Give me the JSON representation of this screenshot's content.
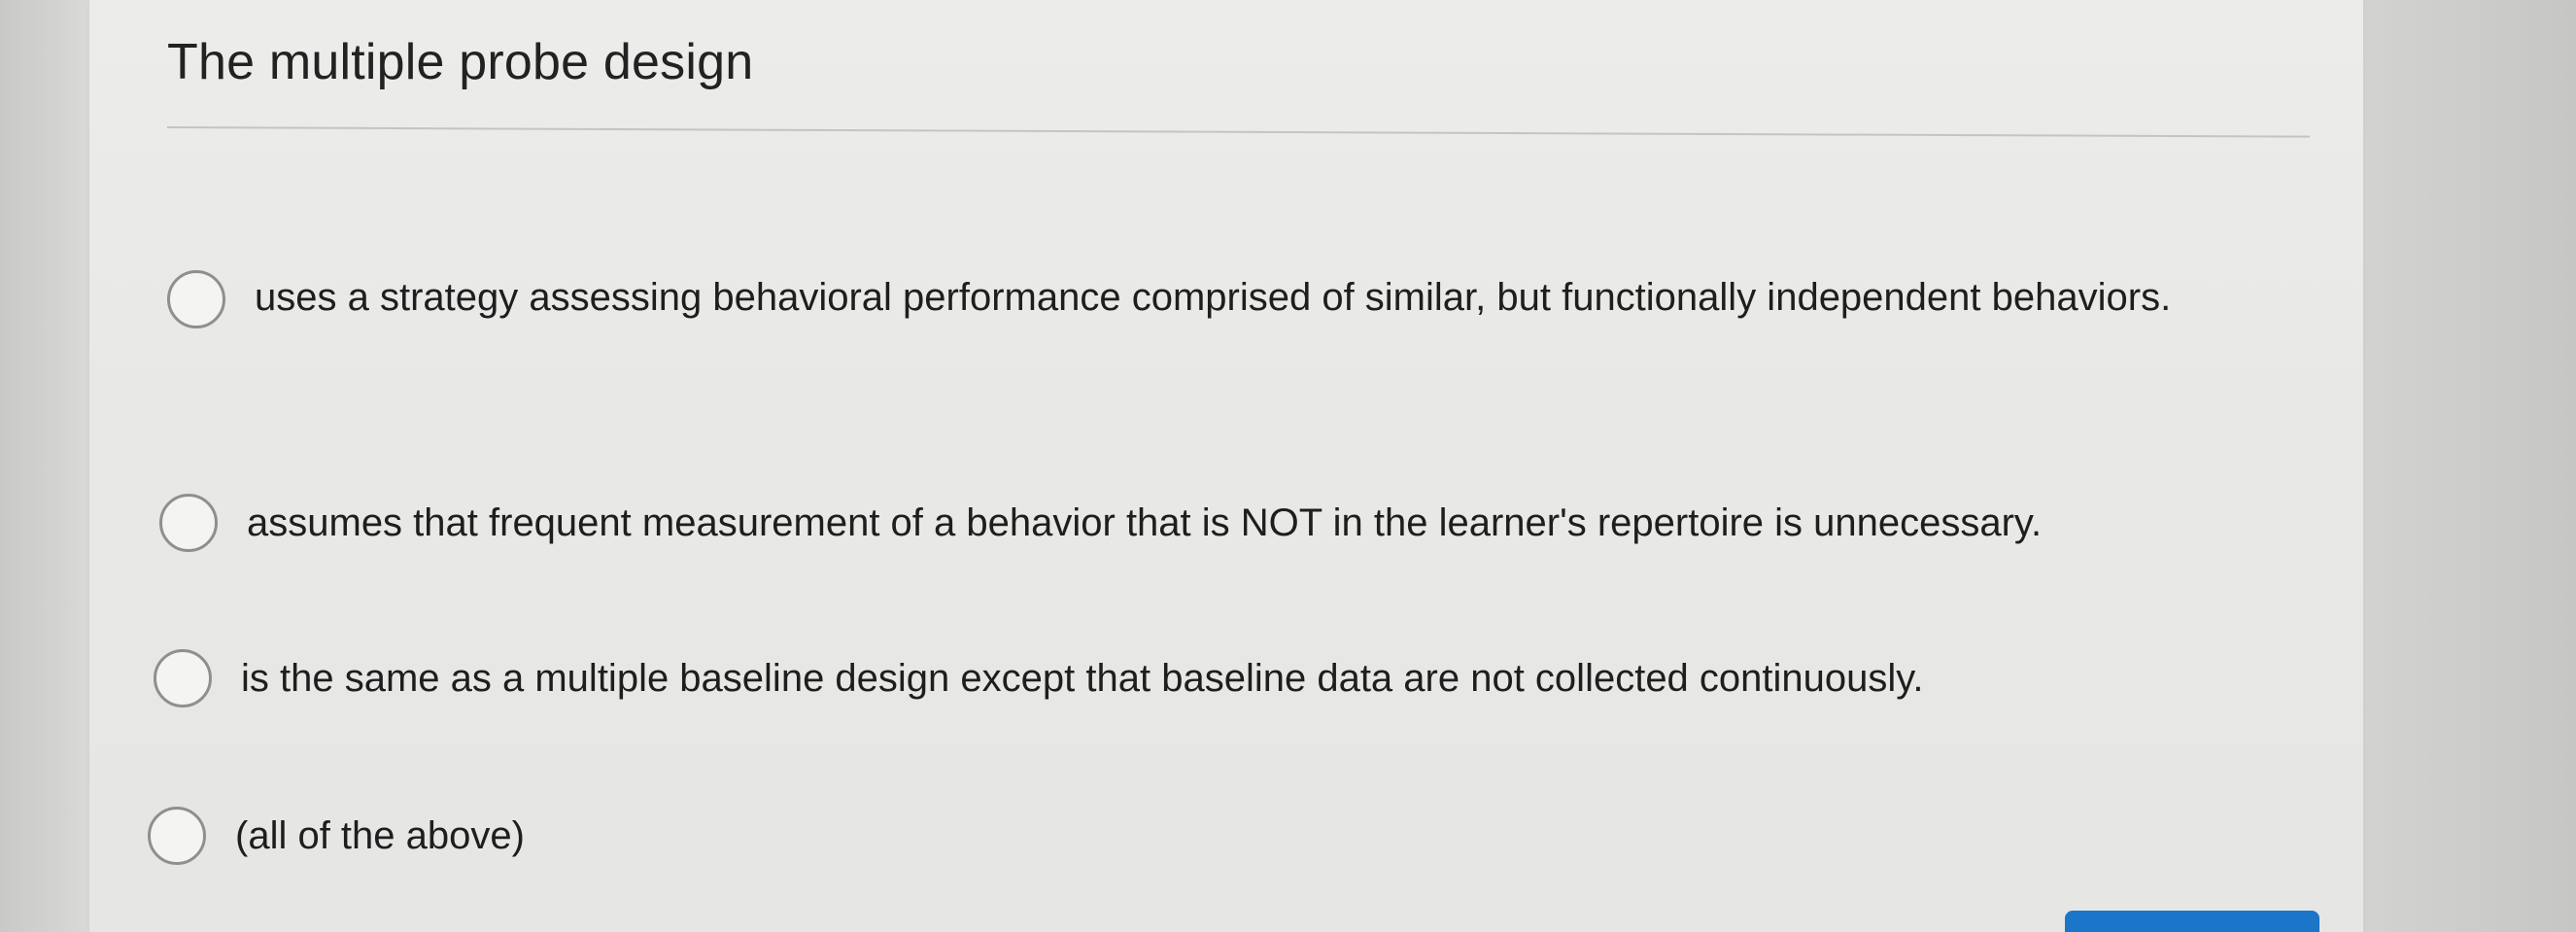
{
  "question": {
    "title": "The multiple probe design"
  },
  "options": [
    {
      "label": "uses a strategy assessing behavioral performance comprised of similar, but functionally independent behaviors."
    },
    {
      "label": "assumes that frequent measurement of a behavior that is NOT in the learner's repertoire is unnecessary."
    },
    {
      "label": "is the same as a multiple baseline design except that baseline data are not collected continuously."
    },
    {
      "label": "(all of the above)"
    }
  ],
  "colors": {
    "accent": "#1b75c8",
    "radio_border": "#8f8f8f"
  },
  "icons": {
    "option_marker": "radio-circle"
  }
}
